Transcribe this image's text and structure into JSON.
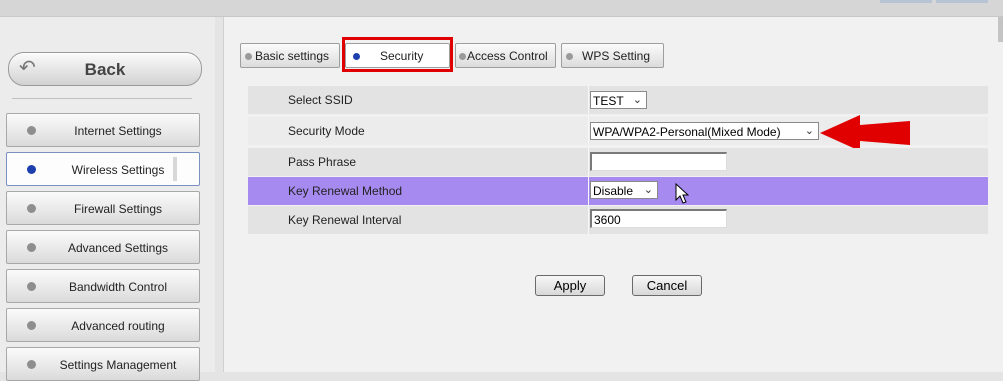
{
  "sidebar": {
    "back_label": "Back",
    "items": [
      {
        "label": "Internet Settings"
      },
      {
        "label": "Wireless Settings"
      },
      {
        "label": "Firewall Settings"
      },
      {
        "label": "Advanced Settings"
      },
      {
        "label": "Bandwidth Control"
      },
      {
        "label": "Advanced routing"
      },
      {
        "label": "Settings Management"
      }
    ]
  },
  "tabs": [
    {
      "label": "Basic settings"
    },
    {
      "label": "Security"
    },
    {
      "label": "Access Control"
    },
    {
      "label": "WPS Setting"
    }
  ],
  "form": {
    "ssid": {
      "label": "Select SSID",
      "value": "TEST"
    },
    "mode": {
      "label": "Security Mode",
      "value": "WPA/WPA2-Personal(Mixed Mode)"
    },
    "pass": {
      "label": "Pass Phrase",
      "value": ""
    },
    "renewal_method": {
      "label": "Key Renewal Method",
      "value": "Disable"
    },
    "renewal_interval": {
      "label": "Key Renewal Interval",
      "value": "3600"
    }
  },
  "buttons": {
    "apply": "Apply",
    "cancel": "Cancel"
  },
  "colors": {
    "highlight_row": "#a78af0",
    "annotation_red": "#e00000",
    "active_dot": "#1d3fae"
  },
  "icons": {
    "back": "back-arrow-icon",
    "annotation": "red-arrow-icon",
    "cursor": "mouse-cursor-icon"
  }
}
